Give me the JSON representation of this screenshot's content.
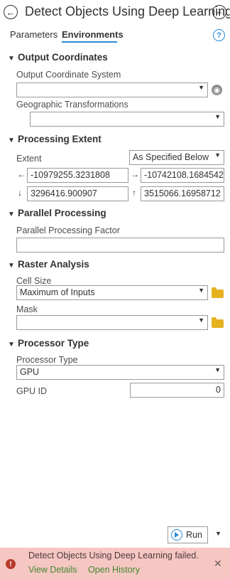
{
  "header": {
    "title": "Detect Objects Using Deep Learning",
    "back_icon": "back-circle-icon",
    "add_icon": "add-circle-icon"
  },
  "tabs": [
    {
      "label": "Parameters",
      "active": false
    },
    {
      "label": "Environments",
      "active": true
    }
  ],
  "accent_color": "#2a8bd6",
  "sections": {
    "output_coordinates": {
      "title": "Output Coordinates",
      "output_cs_label": "Output Coordinate System",
      "output_cs_value": "",
      "geo_trans_label": "Geographic Transformations",
      "geo_trans_value": ""
    },
    "processing_extent": {
      "title": "Processing Extent",
      "extent_label": "Extent",
      "extent_value": "As Specified Below",
      "left": "-10979255.3231808",
      "right": "-10742108.1684542",
      "bottom": "3296416.900907",
      "top": "3515066.16958712"
    },
    "parallel_processing": {
      "title": "Parallel Processing",
      "factor_label": "Parallel Processing Factor",
      "factor_value": ""
    },
    "raster_analysis": {
      "title": "Raster Analysis",
      "cell_size_label": "Cell Size",
      "cell_size_value": "Maximum of Inputs",
      "mask_label": "Mask",
      "mask_value": ""
    },
    "processor_type": {
      "title": "Processor Type",
      "type_label": "Processor Type",
      "type_value": "GPU",
      "gpu_id_label": "GPU ID",
      "gpu_id_value": "0"
    }
  },
  "run": {
    "label": "Run"
  },
  "error": {
    "message": "Detect Objects Using Deep Learning failed.",
    "view_details": "View Details",
    "open_history": "Open History",
    "color": "#f6c6c2"
  }
}
